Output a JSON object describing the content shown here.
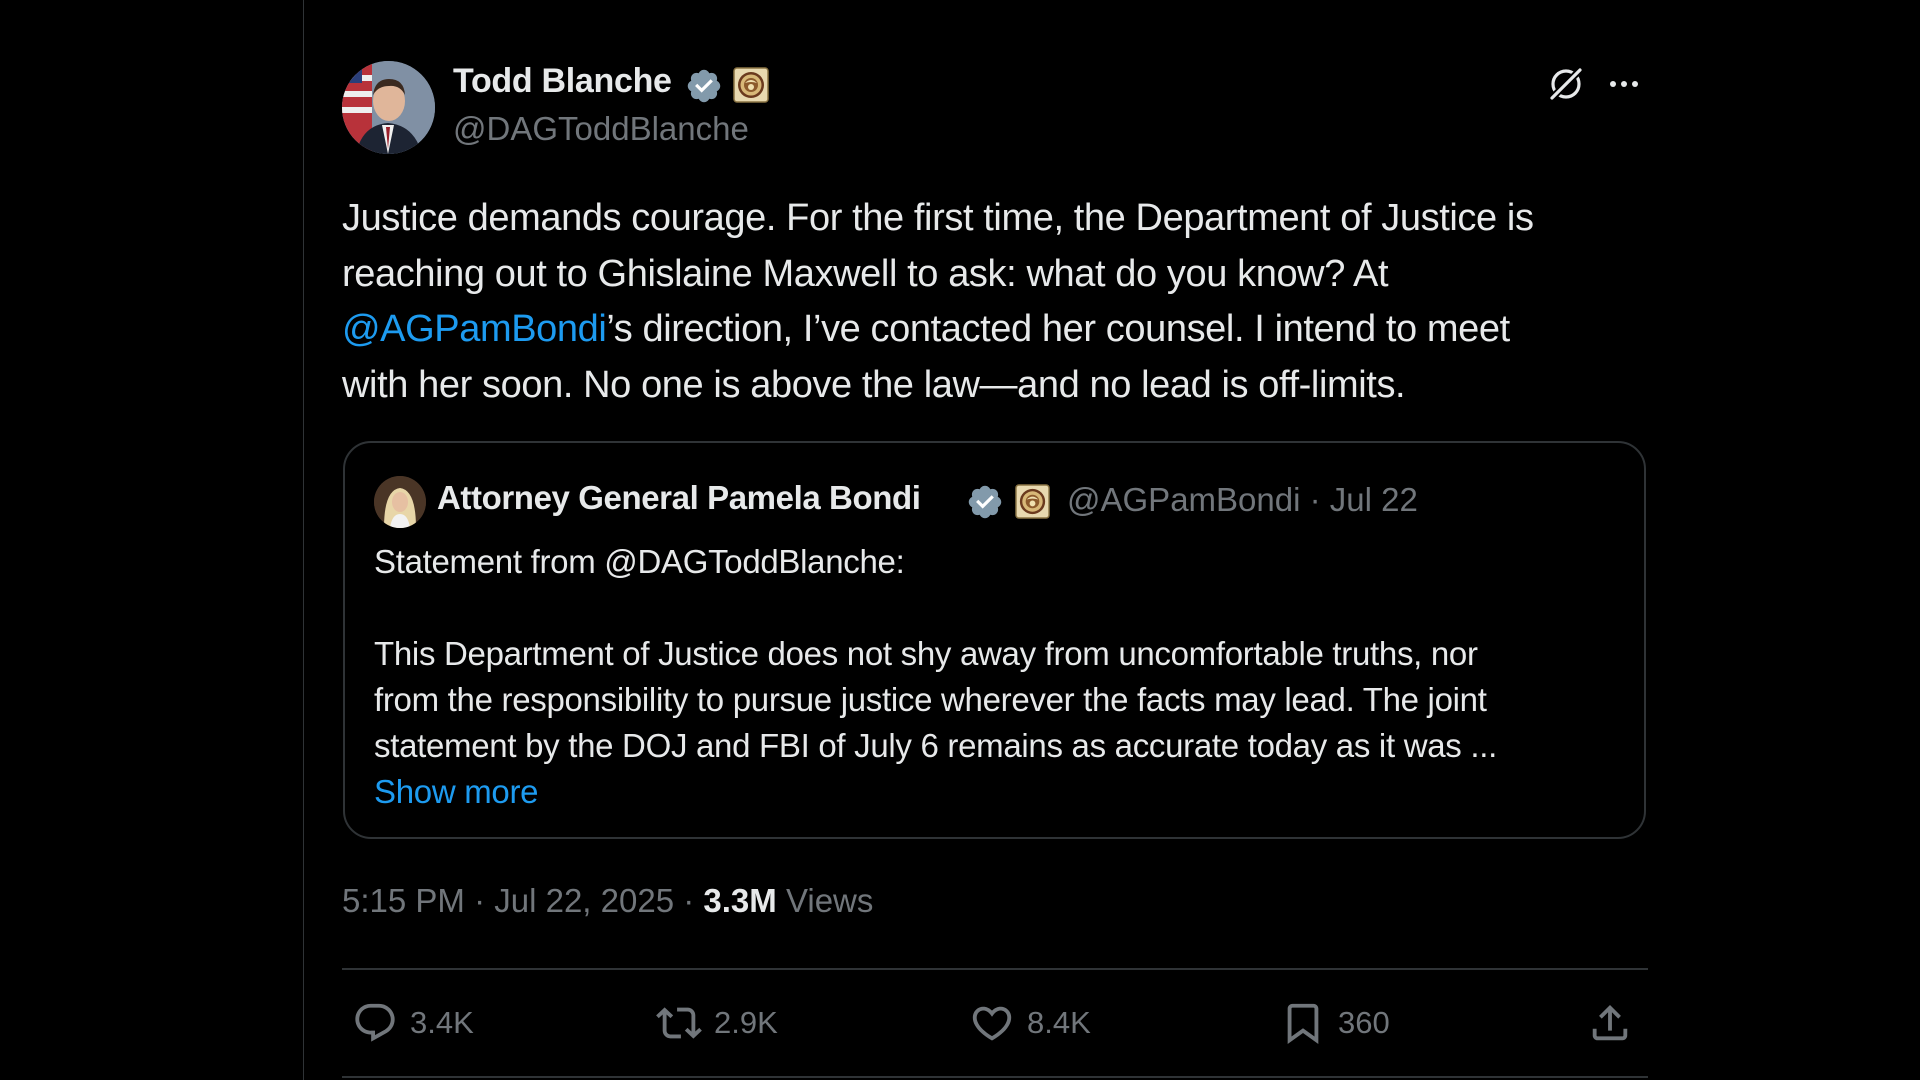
{
  "tweet": {
    "author": {
      "name": "Todd Blanche",
      "handle": "@DAGToddBlanche"
    },
    "text": {
      "line1": "Justice demands courage. For the first time, the Department of Justice is",
      "line2": "reaching out to Ghislaine Maxwell to ask: what do you know? At",
      "line3_mention": "@AGPamBondi",
      "line3_rest": "’s direction, I’ve contacted her counsel. I intend to meet",
      "line4": "with her soon. No one is above the law—and no lead is off-limits."
    },
    "quote": {
      "name": "Attorney General Pamela Bondi",
      "handle": "@AGPamBondi",
      "separator": "·",
      "date": "Jul 22",
      "line1": "Statement from @DAGToddBlanche:",
      "line2": "This Department of Justice does not shy away from uncomfortable truths, nor",
      "line3": "from the responsibility to pursue justice wherever the facts may lead.  The joint",
      "line4": "statement by the DOJ and FBI of July 6 remains as accurate today as it was ...",
      "show_more": "Show more"
    },
    "meta": {
      "time": "5:15 PM",
      "date": "Jul 22, 2025",
      "separator": "·",
      "views_count": "3.3M",
      "views_label": "Views"
    },
    "actions": {
      "replies": "3.4K",
      "reposts": "2.9K",
      "likes": "8.4K",
      "bookmarks": "360"
    }
  },
  "colors": {
    "background": "#000000",
    "text": "#e7e9ea",
    "muted": "#71767b",
    "accent": "#1d9bf0",
    "border": "#2f3336"
  }
}
